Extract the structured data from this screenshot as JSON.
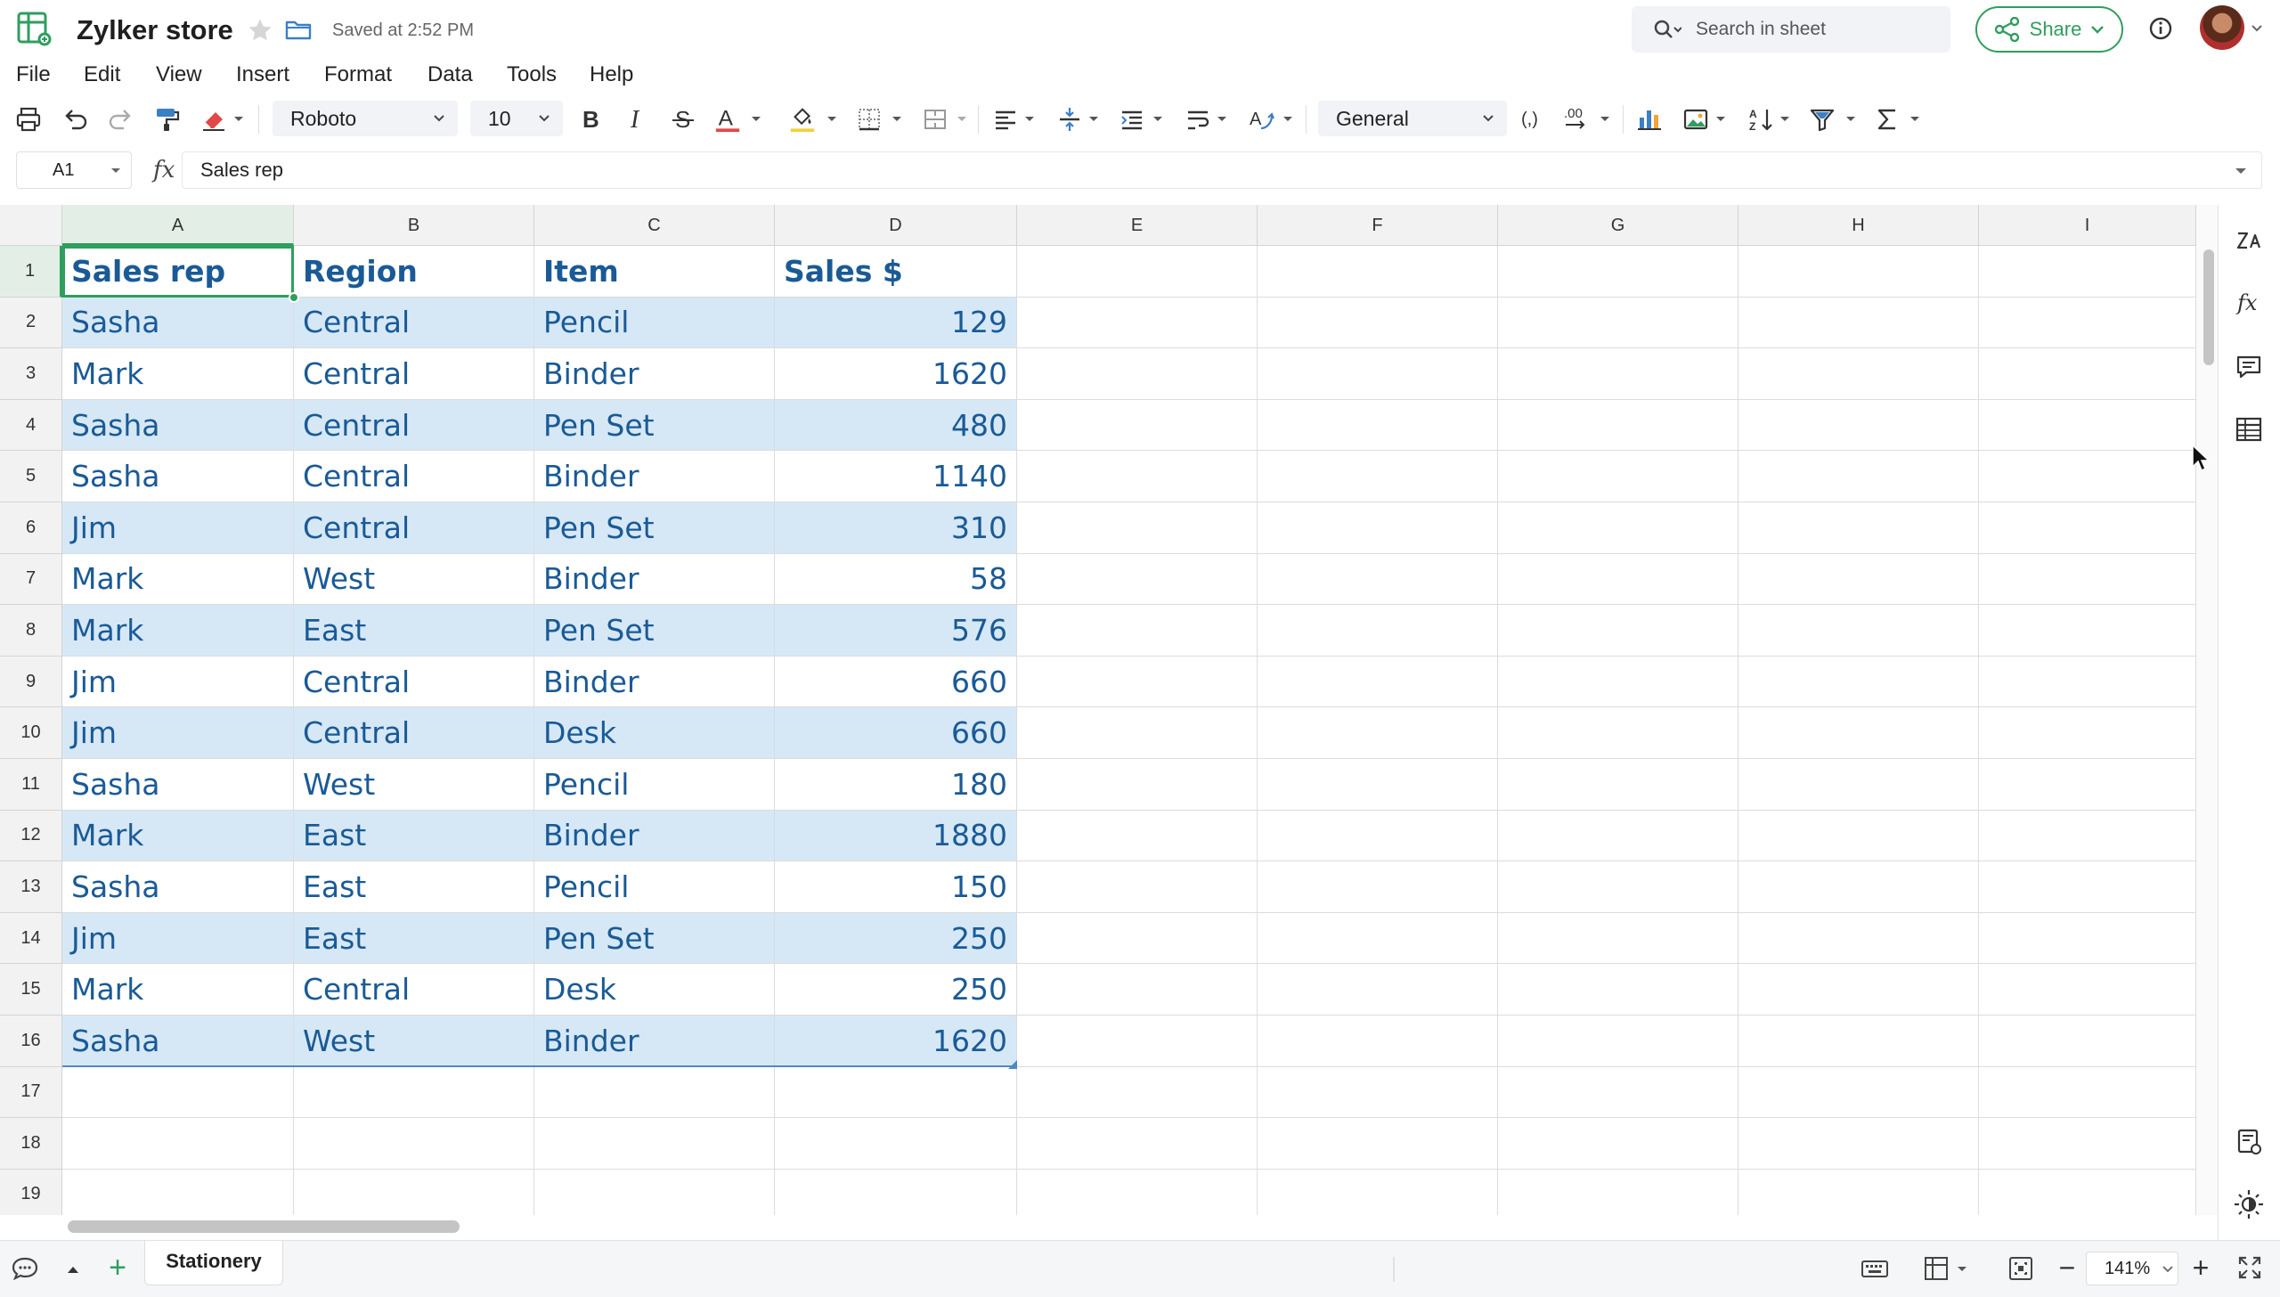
{
  "colors": {
    "accent": "#2f9e5f",
    "cell_text": "#1a5a96",
    "band": "#d6e8f6",
    "range_border": "#4f89c4"
  },
  "titlebar": {
    "doc_title": "Zylker store",
    "saved_status": "Saved at 2:52 PM",
    "search_placeholder": "Search in sheet",
    "share_label": "Share"
  },
  "menu": [
    "File",
    "Edit",
    "View",
    "Insert",
    "Format",
    "Data",
    "Tools",
    "Help"
  ],
  "toolbar": {
    "font_name": "Roboto",
    "font_size": "10",
    "number_format": "General",
    "decimals_label": ".00"
  },
  "formula_bar": {
    "cell_ref": "A1",
    "fx_label": "fx",
    "content": "Sales rep"
  },
  "grid": {
    "columns": [
      "A",
      "B",
      "C",
      "D",
      "E",
      "F",
      "G",
      "H",
      "I"
    ],
    "rows": [
      "1",
      "2",
      "3",
      "4",
      "5",
      "6",
      "7",
      "8",
      "9",
      "10",
      "11",
      "12",
      "13",
      "14",
      "15",
      "16",
      "17",
      "18",
      "19"
    ],
    "header_row": [
      "Sales rep",
      "Region",
      "Item",
      "Sales $"
    ],
    "data_rows": [
      [
        "Sasha",
        "Central",
        "Pencil",
        "129"
      ],
      [
        "Mark",
        "Central",
        "Binder",
        "1620"
      ],
      [
        "Sasha",
        "Central",
        "Pen Set",
        "480"
      ],
      [
        "Sasha",
        "Central",
        "Binder",
        "1140"
      ],
      [
        "Jim",
        "Central",
        "Pen Set",
        "310"
      ],
      [
        "Mark",
        "West",
        "Binder",
        "58"
      ],
      [
        "Mark",
        "East",
        "Pen Set",
        "576"
      ],
      [
        "Jim",
        "Central",
        "Binder",
        "660"
      ],
      [
        "Jim",
        "Central",
        "Desk",
        "660"
      ],
      [
        "Sasha",
        "West",
        "Pencil",
        "180"
      ],
      [
        "Mark",
        "East",
        "Binder",
        "1880"
      ],
      [
        "Sasha",
        "East",
        "Pencil",
        "150"
      ],
      [
        "Jim",
        "East",
        "Pen Set",
        "250"
      ],
      [
        "Mark",
        "Central",
        "Desk",
        "250"
      ],
      [
        "Sasha",
        "West",
        "Binder",
        "1620"
      ]
    ]
  },
  "sheets": {
    "active_tab": "Stationery"
  },
  "statusbar": {
    "zoom": "141%"
  }
}
